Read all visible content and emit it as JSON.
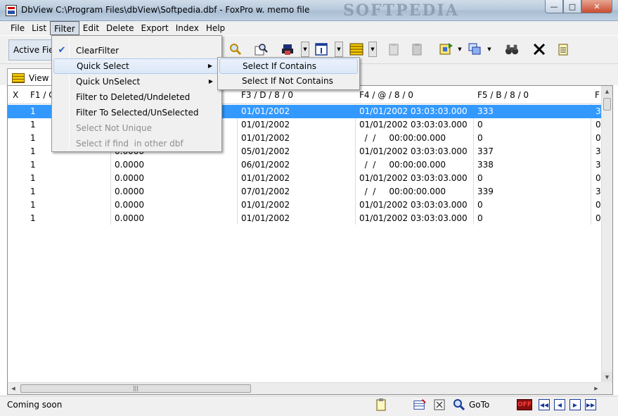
{
  "window": {
    "title": "DbView C:\\Program Files\\dbView\\Softpedia.dbf  -  FoxPro w. memo file",
    "watermark": "SOFTPEDIA"
  },
  "menubar": [
    "File",
    "List",
    "Filter",
    "Edit",
    "Delete",
    "Export",
    "Index",
    "Help"
  ],
  "toolbar": {
    "active_field_label": "Active Field",
    "icons": [
      "search-icon",
      "find-icon",
      "print-icon",
      "info-icon",
      "grid-icon",
      "clipboard-copy-icon",
      "clipboard-paste-icon",
      "selection-icon",
      "copy-icon",
      "binoculars-icon",
      "delete-icon",
      "notes-icon"
    ]
  },
  "view_tab": {
    "label": "View"
  },
  "filter_menu": {
    "items": [
      {
        "label": "ClearFilter",
        "checked": true,
        "disabled": false
      },
      {
        "label": "Quick Select",
        "submenu": true,
        "highlighted": true
      },
      {
        "label": "Quick UnSelect",
        "submenu": true
      },
      {
        "label": "Filter to Deleted/Undeleted"
      },
      {
        "label": "Filter To Selected/UnSelected"
      },
      {
        "label": "Select Not Unique",
        "disabled": true
      },
      {
        "label": "Select if find  in other dbf",
        "disabled": true
      }
    ]
  },
  "quick_select_submenu": {
    "items": [
      {
        "label": "Select If Contains",
        "highlighted": true
      },
      {
        "label": "Select If Not Contains"
      }
    ]
  },
  "grid": {
    "columns": [
      "X",
      "F1 / C",
      "F3 / D / 8 / 0",
      "F4 / @ / 8 / 0",
      "F5 / B / 8 / 0",
      "F"
    ],
    "rows": [
      {
        "f1": "1",
        "f2": "",
        "f3": "01/01/2002",
        "f4": "01/01/2002 03:03:03.000",
        "f5": "333",
        "f6": "3",
        "selected": true
      },
      {
        "f1": "1",
        "f2": "",
        "f3": "01/01/2002",
        "f4": "01/01/2002 03:03:03.000",
        "f5": "0",
        "f6": "0"
      },
      {
        "f1": "1",
        "f2": "",
        "f3": "01/01/2002",
        "f4": "  /  /     00:00:00.000",
        "f5": "0",
        "f6": "0"
      },
      {
        "f1": "1",
        "f2": "0.0000",
        "f3": "05/01/2002",
        "f4": "01/01/2002 03:03:03.000",
        "f5": "337",
        "f6": "3"
      },
      {
        "f1": "1",
        "f2": "0.0000",
        "f3": "06/01/2002",
        "f4": "  /  /     00:00:00.000",
        "f5": "338",
        "f6": "3"
      },
      {
        "f1": "1",
        "f2": "0.0000",
        "f3": "01/01/2002",
        "f4": "01/01/2002 03:03:03.000",
        "f5": "0",
        "f6": "0"
      },
      {
        "f1": "1",
        "f2": "0.0000",
        "f3": "07/01/2002",
        "f4": "  /  /     00:00:00.000",
        "f5": "339",
        "f6": "3"
      },
      {
        "f1": "1",
        "f2": "0.0000",
        "f3": "01/01/2002",
        "f4": "01/01/2002 03:03:03.000",
        "f5": "0",
        "f6": "0"
      },
      {
        "f1": "1",
        "f2": "0.0000",
        "f3": "01/01/2002",
        "f4": "01/01/2002 03:03:03.000",
        "f5": "0",
        "f6": "0"
      }
    ]
  },
  "statusbar": {
    "text": "Coming soon",
    "goto_label": "GoTo",
    "off_label": "OFF"
  },
  "colors": {
    "selection": "#3399ff",
    "menu_highlight": "#dce8f7"
  }
}
